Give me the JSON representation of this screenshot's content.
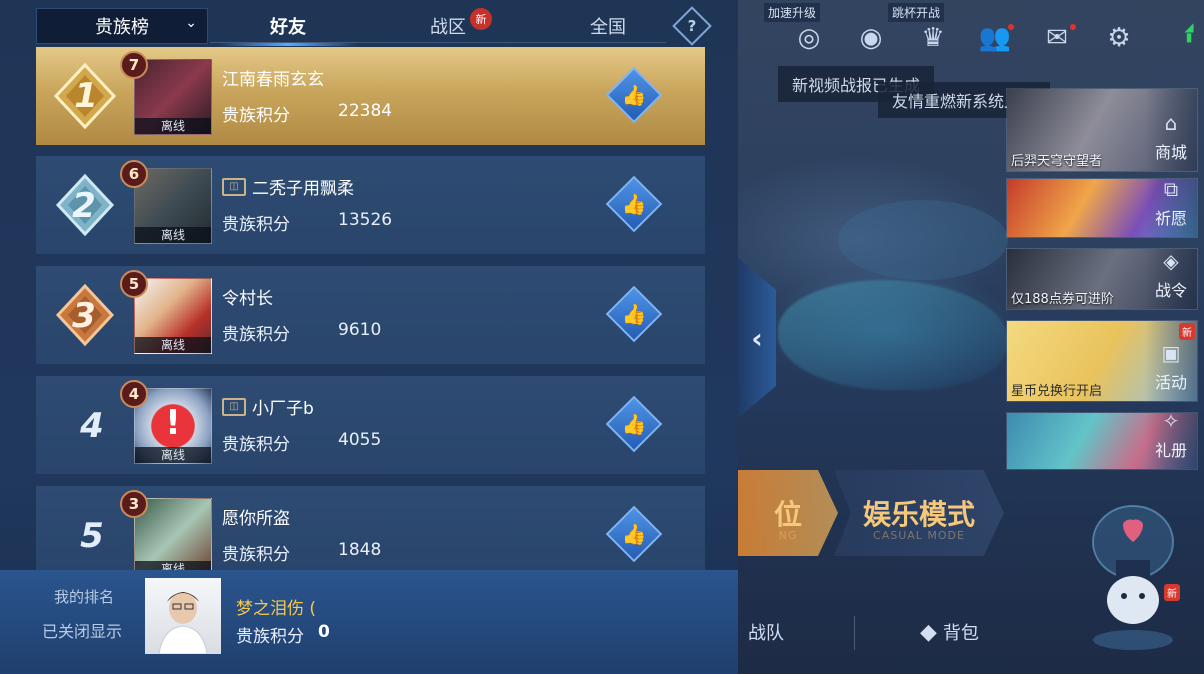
{
  "header": {
    "dropdown_label": "贵族榜",
    "tabs": [
      {
        "label": "好友",
        "active": true
      },
      {
        "label": "战区",
        "badge": "新"
      },
      {
        "label": "全国"
      }
    ],
    "help_label": "?"
  },
  "leaderboard": {
    "score_label": "贵族积分",
    "offline_label": "离线",
    "rows": [
      {
        "rank": "1",
        "level": "7",
        "name": "江南春雨玄玄",
        "score": "22384",
        "has_frame": false
      },
      {
        "rank": "2",
        "level": "6",
        "name": "二秃子用飘柔",
        "score": "13526",
        "has_frame": true
      },
      {
        "rank": "3",
        "level": "5",
        "name": "令村长",
        "score": "9610",
        "has_frame": false
      },
      {
        "rank": "4",
        "level": "4",
        "name": "小厂子b",
        "score": "4055",
        "has_frame": true
      },
      {
        "rank": "5",
        "level": "3",
        "name": "愿你所盗",
        "score": "1848",
        "has_frame": false
      }
    ]
  },
  "my_rank": {
    "title": "我的排名",
    "status": "已关闭显示",
    "nickname": "梦之泪伤 (",
    "score_label": "贵族积分",
    "score": "0"
  },
  "lobby": {
    "top_tags": [
      "加速升级",
      "跳杯开战"
    ],
    "toasts": [
      "新视频战报已生成",
      "友情重燃新系统上线"
    ],
    "promos": [
      {
        "caption": "后羿天穹守望者",
        "label": "商城",
        "icon": "shop-icon"
      },
      {
        "caption": "",
        "label": "祈愿",
        "icon": "wish-icon"
      },
      {
        "caption": "仅188点券可进阶",
        "label": "战令",
        "icon": "pass-icon"
      },
      {
        "caption": "星币兑换行开启",
        "label": "活动",
        "icon": "event-icon",
        "badge": "新"
      },
      {
        "caption": "",
        "label": "礼册",
        "icon": "gift-icon"
      }
    ],
    "mode_left": "位",
    "mode_left_sub": "NG",
    "mode_right": "娱乐模式",
    "mode_right_sub": "CASUAL MODE",
    "bottom_nav": [
      "战队",
      "背包"
    ],
    "mascot_badge": "新"
  },
  "colors": {
    "first_row_gold": "#c9a55c",
    "row_blue": "#2e4b73",
    "nickname_gold": "#f4c84e",
    "badge_red": "#c8302a"
  }
}
